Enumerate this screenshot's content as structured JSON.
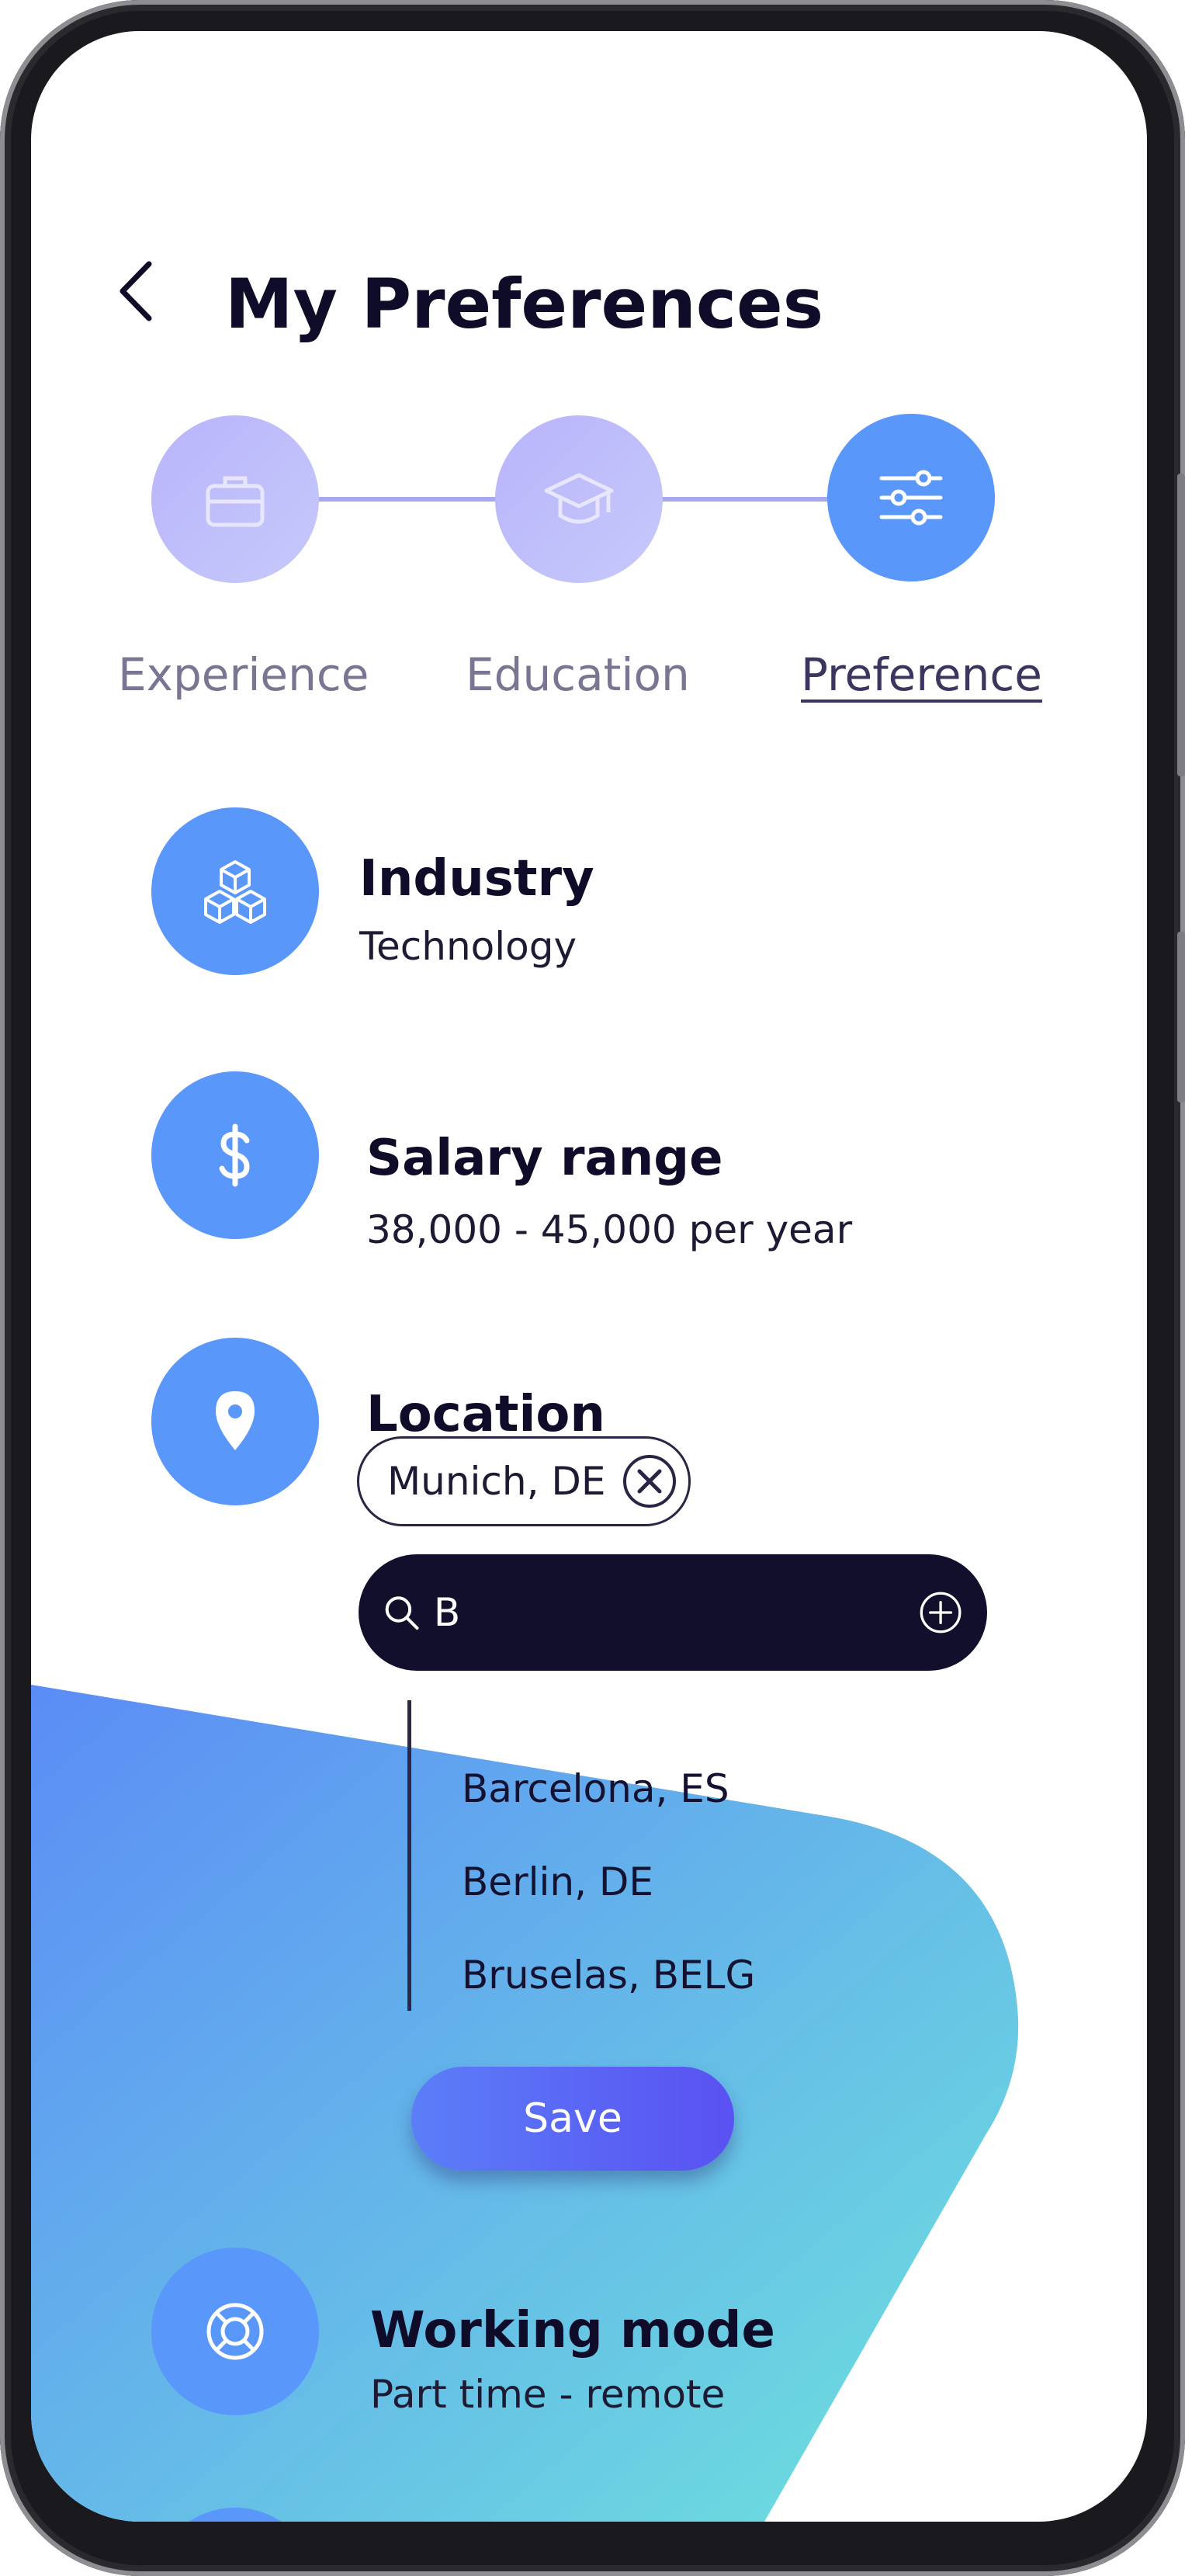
{
  "header": {
    "title": "My Preferences"
  },
  "steps": [
    {
      "label": "Experience",
      "icon": "briefcase-icon",
      "state": "complete"
    },
    {
      "label": "Education",
      "icon": "graduation-cap-icon",
      "state": "complete"
    },
    {
      "label": "Preference",
      "icon": "sliders-icon",
      "state": "active"
    }
  ],
  "preferences": {
    "industry": {
      "title": "Industry",
      "value": "Technology",
      "icon": "cubes-icon"
    },
    "salary": {
      "title": "Salary range",
      "value": "38,000 - 45,000 per year",
      "icon": "dollar-icon"
    },
    "location": {
      "title": "Location",
      "icon": "map-pin-icon",
      "selected": [
        "Munich, DE"
      ],
      "search_value": "B",
      "suggestions": [
        "Barcelona, ES",
        "Berlin, DE",
        "Bruselas, BELG"
      ]
    },
    "working_mode": {
      "title": "Working mode",
      "value": "Part time - remote",
      "icon": "lifebuoy-icon"
    }
  },
  "actions": {
    "save_label": "Save"
  },
  "colors": {
    "accent": "#5a97fb",
    "step_inactive": "#bcb8fb",
    "search_bg": "#110f2b",
    "save_gradient_start": "#5b7ef8",
    "save_gradient_end": "#5a51f2",
    "wave_gradient_start": "#5b8cf6",
    "wave_gradient_end": "#6ee3dc",
    "text_dark": "#0f0c29"
  }
}
